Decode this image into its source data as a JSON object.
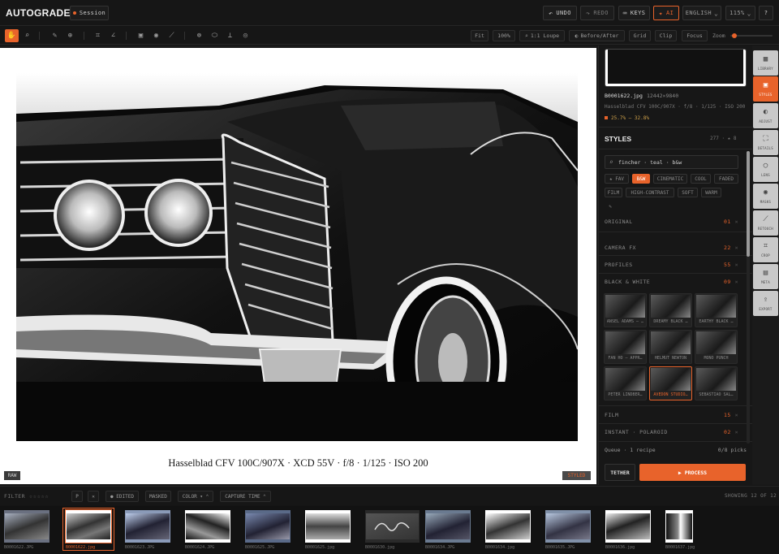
{
  "app": {
    "name": "AUTOGRADE"
  },
  "topbar": {
    "session": "Session",
    "undo": "UNDO",
    "redo": "REDO",
    "keys": "KEYS",
    "ai": "AI",
    "language": "ENGLISH",
    "zoom": "115%",
    "help": "?"
  },
  "toolbar": {
    "tooltip": "pan",
    "fit": "Fit",
    "hundred": "100%",
    "loupe": "1:1 Loupe",
    "before_after": "Before/After",
    "grid": "Grid",
    "clip": "Clip",
    "focus": "Focus",
    "zoom_label": "Zoom",
    "zoom_level": 0.05
  },
  "canvas": {
    "caption": "Hasselblad CFV 100C/907X  ·  XCD 55V  ·  f/8 · 1/125 · ISO 200",
    "raw_badge": "RAW",
    "styled_badge": "STYLED"
  },
  "panel": {
    "file_name": "B0001622.jpg",
    "file_dims": "12442×9840",
    "file_meta": "Hasselblad CFV 100C/907X · f/8 · 1/125 · ISO 200",
    "file_range": "25.7% – 32.8%",
    "styles_title": "STYLES",
    "styles_count": "277 · ★ 8",
    "search_value": "fincher · teal · b&w",
    "chips": [
      {
        "label": "★ FAV",
        "on": false
      },
      {
        "label": "B&W",
        "on": true
      },
      {
        "label": "CINEMATIC",
        "on": false
      },
      {
        "label": "COOL",
        "on": false
      },
      {
        "label": "FADED",
        "on": false
      },
      {
        "label": "FILM",
        "on": false
      },
      {
        "label": "HIGH-CONTRAST",
        "on": false
      },
      {
        "label": "SOFT",
        "on": false
      },
      {
        "label": "WARM",
        "on": false
      },
      {
        "label": "✎",
        "on": false
      }
    ],
    "categories": [
      {
        "name": "ORIGINAL",
        "count": "01"
      },
      {
        "name": "CAMERA FX",
        "count": "22"
      },
      {
        "name": "PROFILES",
        "count": "55"
      },
      {
        "name": "BLACK & WHITE",
        "count": "09"
      },
      {
        "name": "FILM",
        "count": "15"
      },
      {
        "name": "INSTANT · POLAROID",
        "count": "02"
      }
    ],
    "bw_styles": [
      "ANSEL ADAMS – …",
      "DREAMY BLACK …",
      "EARTHY BLACK …",
      "FAN HO – APPR…",
      "HELMUT NEWTON",
      "MONO PUNCH",
      "PETER LINDBER…",
      "AVEDON STUDIO…",
      "SEBASTIAO SAL…"
    ],
    "queue_label": "Queue · 1 recipe",
    "queue_picks": "0/8 picks",
    "tether": "TETHER",
    "process": "▶ PROCESS"
  },
  "rail": [
    {
      "label": "LIBRARY",
      "icon": "▦"
    },
    {
      "label": "STYLES",
      "icon": "▣"
    },
    {
      "label": "ADJUST",
      "icon": "◐"
    },
    {
      "label": "DETAILS",
      "icon": "⛶"
    },
    {
      "label": "LENS",
      "icon": "◯"
    },
    {
      "label": "MASKS",
      "icon": "◉"
    },
    {
      "label": "RETOUCH",
      "icon": "⟋"
    },
    {
      "label": "CROP",
      "icon": "⌗"
    },
    {
      "label": "META",
      "icon": "▤"
    },
    {
      "label": "EXPORT",
      "icon": "⇪"
    }
  ],
  "filterbar": {
    "filter": "FILTER",
    "stars": "☆☆☆☆☆",
    "flag": "P",
    "reject": "✕",
    "edited": "● EDITED",
    "masked": "MASKED",
    "color": "COLOR ▾ ⌃",
    "capture": "CAPTURE TIME ⌃",
    "showing": "SHOWING 12 OF 12"
  },
  "filmstrip": [
    "B0001622.JPG",
    "B0001622.jpg",
    "B0001623.JPG",
    "B0001624.JPG",
    "B0001625.JPG",
    "B0001625.jpg",
    "B0001630.jpg",
    "B0001634.JPG",
    "B0001634.jpg",
    "B0001635.JPG",
    "B0001636.jpg",
    "B0001637.jpg"
  ]
}
